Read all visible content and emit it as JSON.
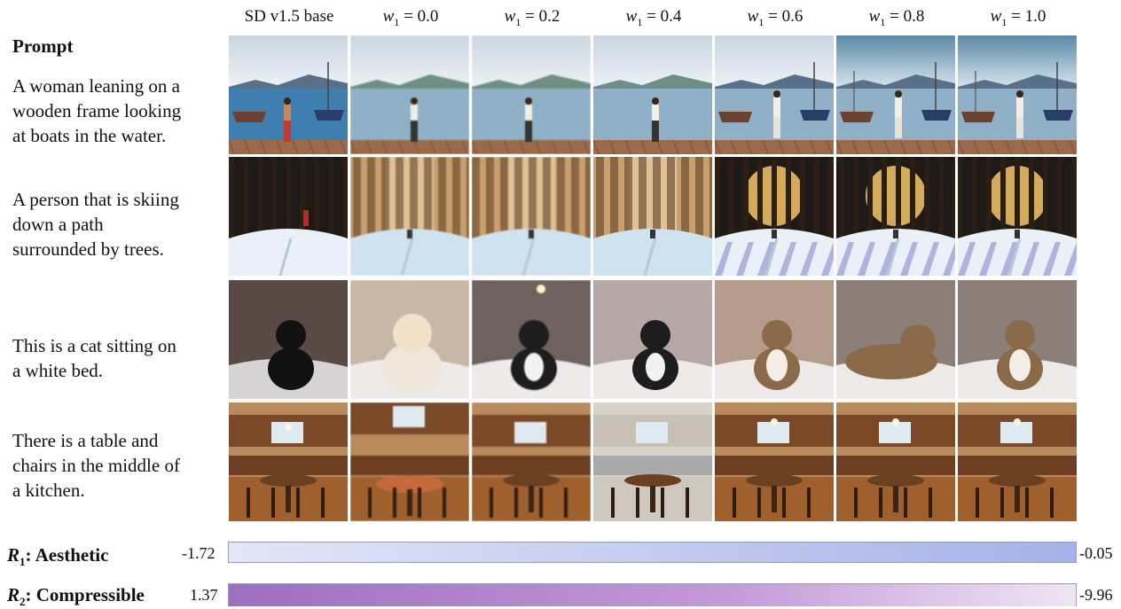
{
  "columns": [
    "SD v1.5 base",
    "0.0",
    "0.2",
    "0.4",
    "0.6",
    "0.8",
    "1.0"
  ],
  "weight_symbol": "w",
  "weight_subscript": "1",
  "prompt_header": "Prompt",
  "prompts": [
    {
      "lines": [
        "A woman leaning on a",
        "wooden frame looking",
        "at boats in the water."
      ]
    },
    {
      "lines": [
        "A person that is skiing",
        "down a path",
        "surrounded by trees."
      ]
    },
    {
      "lines": [
        "This is a cat sitting on",
        "a white bed."
      ]
    },
    {
      "lines": [
        "There is a table and",
        "chairs in the middle of",
        "a kitchen."
      ]
    }
  ],
  "bars": [
    {
      "symbol": "R",
      "subscript": "1",
      "label": ": Aesthetic",
      "min": "-1.72",
      "max": "-0.05",
      "min_color": "#e2e6f6",
      "max_color": "#a5b2e8"
    },
    {
      "symbol": "R",
      "subscript": "2",
      "label": ": Compressible",
      "min": "1.37",
      "max": "-9.96",
      "min_color": "#9e6ec0",
      "max_color": "#efe5f4"
    }
  ]
}
